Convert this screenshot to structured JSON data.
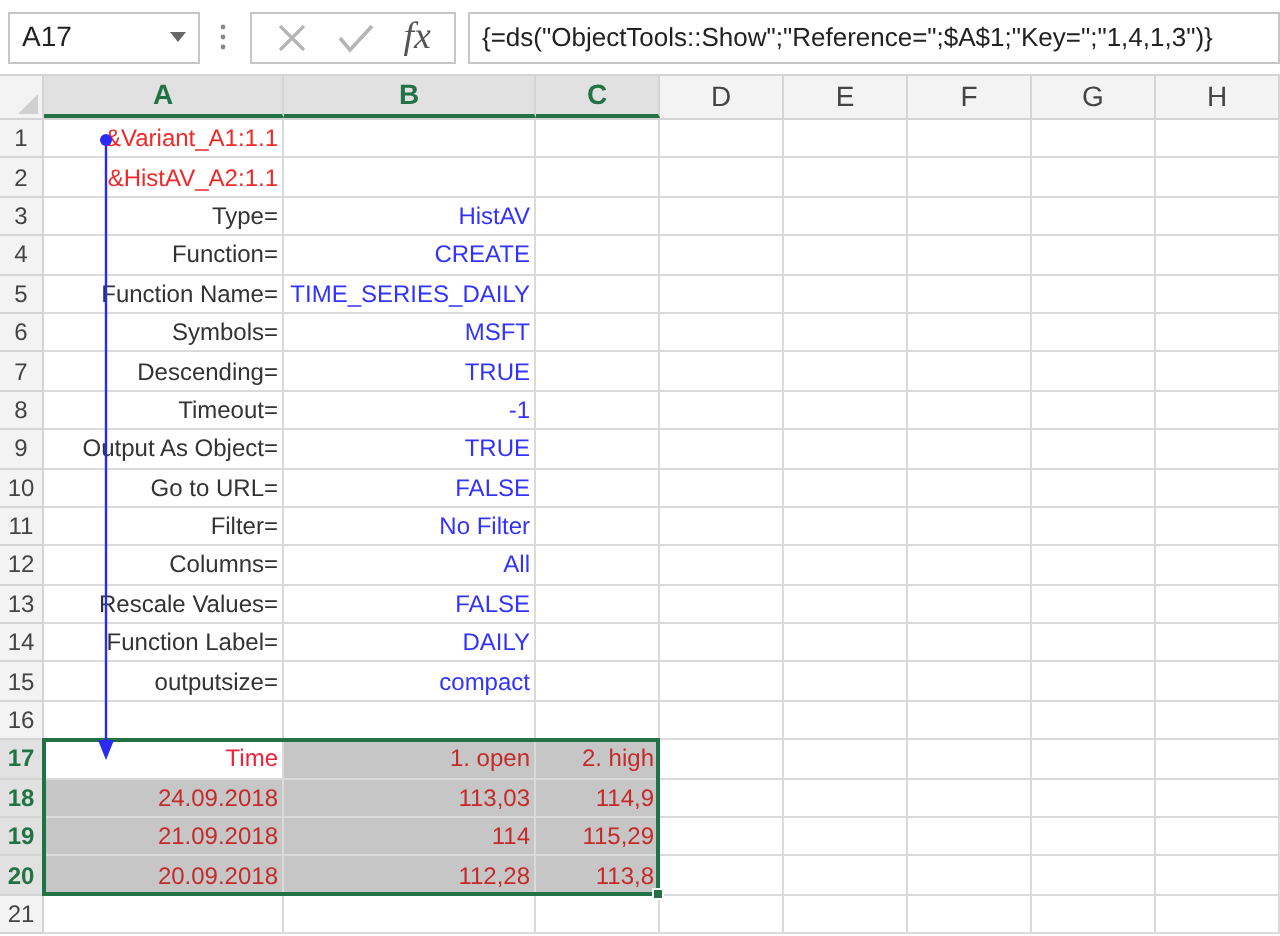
{
  "name_box": {
    "value": "A17"
  },
  "formula_bar": {
    "function_label": "fx",
    "formula": "{=ds(\"ObjectTools::Show\";\"Reference=\";$A$1;\"Key=\";\"1,4,1,3\")}"
  },
  "columns": [
    {
      "label": "A",
      "selected": true
    },
    {
      "label": "B",
      "selected": true
    },
    {
      "label": "C",
      "selected": true
    },
    {
      "label": "D",
      "selected": false
    },
    {
      "label": "E",
      "selected": false
    },
    {
      "label": "F",
      "selected": false
    },
    {
      "label": "G",
      "selected": false
    },
    {
      "label": "H",
      "selected": false
    }
  ],
  "rows": [
    {
      "number": "1",
      "selected": false,
      "cells": [
        {
          "text": "&Variant_A1:1.1",
          "kind": "reference"
        }
      ]
    },
    {
      "number": "2",
      "selected": false,
      "cells": [
        {
          "text": "&HistAV_A2:1.1",
          "kind": "reference"
        }
      ]
    },
    {
      "number": "3",
      "selected": false,
      "cells": [
        {
          "text": "Type=",
          "kind": "label"
        },
        {
          "text": "HistAV",
          "kind": "value"
        }
      ]
    },
    {
      "number": "4",
      "selected": false,
      "cells": [
        {
          "text": "Function=",
          "kind": "label"
        },
        {
          "text": "CREATE",
          "kind": "value"
        }
      ]
    },
    {
      "number": "5",
      "selected": false,
      "cells": [
        {
          "text": "Function Name=",
          "kind": "label"
        },
        {
          "text": "TIME_SERIES_DAILY",
          "kind": "value"
        }
      ]
    },
    {
      "number": "6",
      "selected": false,
      "cells": [
        {
          "text": "Symbols=",
          "kind": "label"
        },
        {
          "text": "MSFT",
          "kind": "value"
        }
      ]
    },
    {
      "number": "7",
      "selected": false,
      "cells": [
        {
          "text": "Descending=",
          "kind": "label"
        },
        {
          "text": "TRUE",
          "kind": "value"
        }
      ]
    },
    {
      "number": "8",
      "selected": false,
      "cells": [
        {
          "text": "Timeout=",
          "kind": "label"
        },
        {
          "text": "-1",
          "kind": "value"
        }
      ]
    },
    {
      "number": "9",
      "selected": false,
      "cells": [
        {
          "text": "Output As Object=",
          "kind": "label"
        },
        {
          "text": "TRUE",
          "kind": "value"
        }
      ]
    },
    {
      "number": "10",
      "selected": false,
      "cells": [
        {
          "text": "Go to URL=",
          "kind": "label"
        },
        {
          "text": "FALSE",
          "kind": "value"
        }
      ]
    },
    {
      "number": "11",
      "selected": false,
      "cells": [
        {
          "text": "Filter=",
          "kind": "label"
        },
        {
          "text": "No Filter",
          "kind": "value"
        }
      ]
    },
    {
      "number": "12",
      "selected": false,
      "cells": [
        {
          "text": "Columns=",
          "kind": "label"
        },
        {
          "text": "All",
          "kind": "value"
        }
      ]
    },
    {
      "number": "13",
      "selected": false,
      "cells": [
        {
          "text": "Rescale Values=",
          "kind": "label"
        },
        {
          "text": "FALSE",
          "kind": "value"
        }
      ]
    },
    {
      "number": "14",
      "selected": false,
      "cells": [
        {
          "text": "Function Label=",
          "kind": "label"
        },
        {
          "text": "DAILY",
          "kind": "value"
        }
      ]
    },
    {
      "number": "15",
      "selected": false,
      "cells": [
        {
          "text": "outputsize=",
          "kind": "label"
        },
        {
          "text": "compact",
          "kind": "value"
        }
      ]
    },
    {
      "number": "16",
      "selected": false,
      "cells": []
    },
    {
      "number": "17",
      "selected": true,
      "cells": [
        {
          "text": "Time",
          "kind": "header",
          "selected": false
        },
        {
          "text": "1. open",
          "kind": "data",
          "selected": true
        },
        {
          "text": "2. high",
          "kind": "data",
          "selected": true
        }
      ]
    },
    {
      "number": "18",
      "selected": true,
      "cells": [
        {
          "text": "24.09.2018",
          "kind": "data",
          "selected": true
        },
        {
          "text": "113,03",
          "kind": "data",
          "selected": true
        },
        {
          "text": "114,9",
          "kind": "data",
          "selected": true
        }
      ]
    },
    {
      "number": "19",
      "selected": true,
      "cells": [
        {
          "text": "21.09.2018",
          "kind": "data",
          "selected": true
        },
        {
          "text": "114",
          "kind": "data",
          "selected": true
        },
        {
          "text": "115,29",
          "kind": "data",
          "selected": true
        }
      ]
    },
    {
      "number": "20",
      "selected": true,
      "cells": [
        {
          "text": "20.09.2018",
          "kind": "data",
          "selected": true
        },
        {
          "text": "112,28",
          "kind": "data",
          "selected": true
        },
        {
          "text": "113,8",
          "kind": "data",
          "selected": true
        }
      ]
    },
    {
      "number": "21",
      "selected": false,
      "cells": []
    }
  ]
}
